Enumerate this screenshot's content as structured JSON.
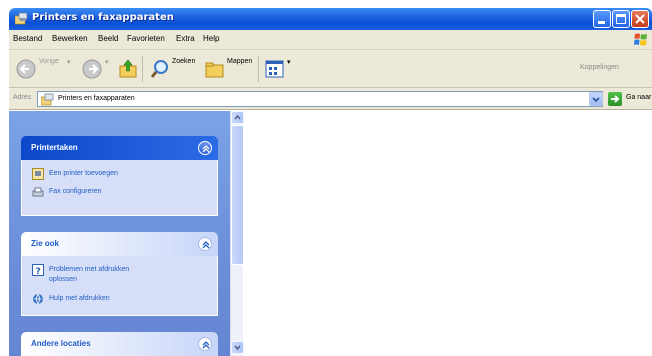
{
  "window": {
    "title": "Printers en faxapparaten",
    "icon": "printer-folder-icon",
    "controls": [
      "minimize-icon",
      "maximize-icon",
      "close-icon"
    ]
  },
  "menubar": {
    "items": [
      "Bestand",
      "Bewerken",
      "Beeld",
      "Favorieten",
      "Extra",
      "Help"
    ],
    "logo": "windows-flag-icon"
  },
  "toolbar": {
    "back_label": "Vorige",
    "search_label": "Zoeken",
    "folders_label": "Mappen",
    "links_label": "Koppelingen"
  },
  "address": {
    "label": "Adres",
    "value": "Printers en faxapparaten",
    "go_label": "Ga naar"
  },
  "taskpane": {
    "panels": [
      {
        "title": "Printertaken",
        "links": [
          "Een printer toevoegen",
          "Fax configureren"
        ]
      },
      {
        "title": "Zie ook",
        "links": [
          "Problemen met afdrukken oplossen",
          "Hulp met afdrukken"
        ]
      },
      {
        "title": "Andere locaties",
        "links": []
      }
    ]
  },
  "colors": {
    "titlebar": "#0a4fd6",
    "taskpane_bg": "#6b8fd9",
    "panel_body": "#d6dff7",
    "link": "#215dc6",
    "chrome": "#ece9d8"
  }
}
